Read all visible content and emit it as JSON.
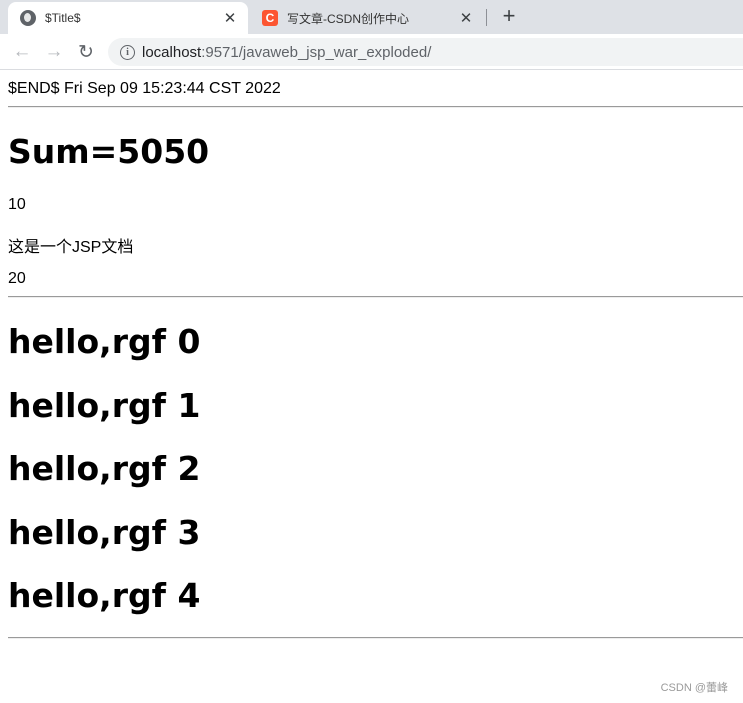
{
  "browser": {
    "tabs": [
      {
        "title": "$Title$",
        "active": true,
        "favicon": "globe-icon"
      },
      {
        "title": "写文章-CSDN创作中心",
        "active": false,
        "favicon": "csdn-logo-icon",
        "favicon_letter": "C"
      }
    ],
    "close_glyph": "✕",
    "new_tab_glyph": "+",
    "nav": {
      "back": "←",
      "forward": "→",
      "reload": "↻"
    },
    "url_host": "localhost",
    "url_rest": ":9571/javaweb_jsp_war_exploded/",
    "info_glyph": "i"
  },
  "page": {
    "end_line": "$END$ Fri Sep 09 15:23:44 CST 2022",
    "sum_heading": "Sum=5050",
    "value_1": "10",
    "doc_line": "这是一个JSP文档",
    "value_2": "20",
    "hello_lines": [
      "hello,rgf 0",
      "hello,rgf 1",
      "hello,rgf 2",
      "hello,rgf 3",
      "hello,rgf 4"
    ]
  },
  "watermark": "CSDN @蕾峰",
  "colors": {
    "csdn_brand": "#fc5531",
    "tabstrip_bg": "#dee1e6",
    "omnibox_bg": "#f1f3f4"
  }
}
